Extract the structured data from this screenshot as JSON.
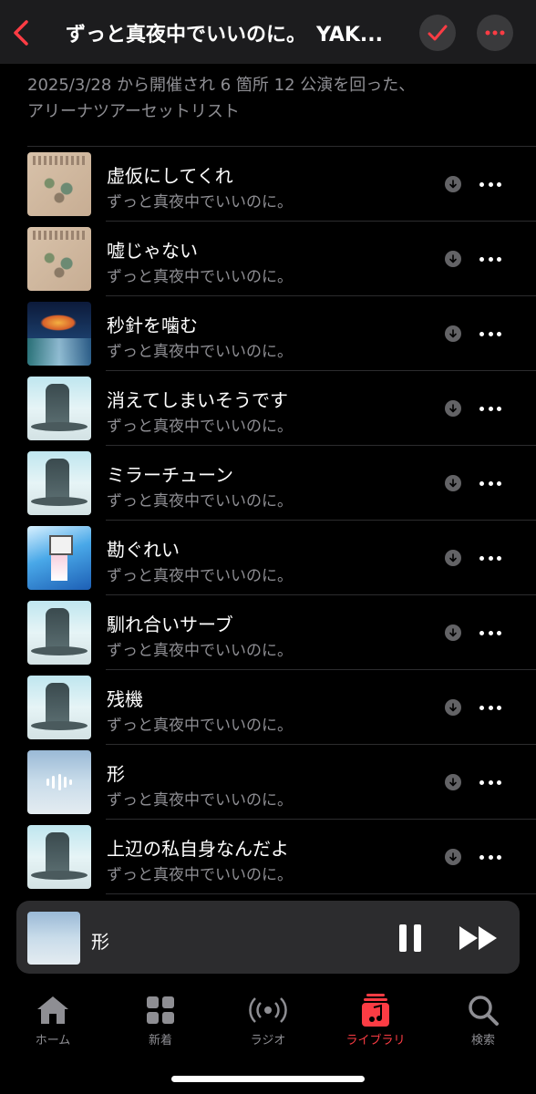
{
  "header": {
    "title": "ずっと真夜中でいいのに。　YAK...",
    "back_icon": "chevron-left-icon",
    "check_icon": "checkmark-icon",
    "more_icon": "ellipsis-icon",
    "accent": "#fc3c44"
  },
  "description": {
    "line1": "2025/3/28 から開催され 6 箇所 12 公演を回った、",
    "line2": "アリーナツアーセットリスト"
  },
  "tracks": [
    {
      "title": "虚仮にしてくれ",
      "artist": "ずっと真夜中でいいのに。",
      "art": "art-a"
    },
    {
      "title": "嘘じゃない",
      "artist": "ずっと真夜中でいいのに。",
      "art": "art-a"
    },
    {
      "title": "秒針を噛む",
      "artist": "ずっと真夜中でいいのに。",
      "art": "art-b"
    },
    {
      "title": "消えてしまいそうです",
      "artist": "ずっと真夜中でいいのに。",
      "art": "art-c"
    },
    {
      "title": "ミラーチューン",
      "artist": "ずっと真夜中でいいのに。",
      "art": "art-c"
    },
    {
      "title": "勘ぐれい",
      "artist": "ずっと真夜中でいいのに。",
      "art": "art-d"
    },
    {
      "title": "馴れ合いサーブ",
      "artist": "ずっと真夜中でいいのに。",
      "art": "art-c"
    },
    {
      "title": "残機",
      "artist": "ずっと真夜中でいいのに。",
      "art": "art-c"
    },
    {
      "title": "形",
      "artist": "ずっと真夜中でいいのに。",
      "art": "art-e",
      "playing": true
    },
    {
      "title": "上辺の私自身なんだよ",
      "artist": "ずっと真夜中でいいのに。",
      "art": "art-c"
    }
  ],
  "player": {
    "title": "形",
    "pause_icon": "pause-icon",
    "forward_icon": "fast-forward-icon"
  },
  "tabs": [
    {
      "label": "ホーム",
      "icon": "home-icon",
      "active": false
    },
    {
      "label": "新着",
      "icon": "grid-icon",
      "active": false
    },
    {
      "label": "ラジオ",
      "icon": "radio-icon",
      "active": false
    },
    {
      "label": "ライブラリ",
      "icon": "library-icon",
      "active": true
    },
    {
      "label": "検索",
      "icon": "search-icon",
      "active": false
    }
  ]
}
